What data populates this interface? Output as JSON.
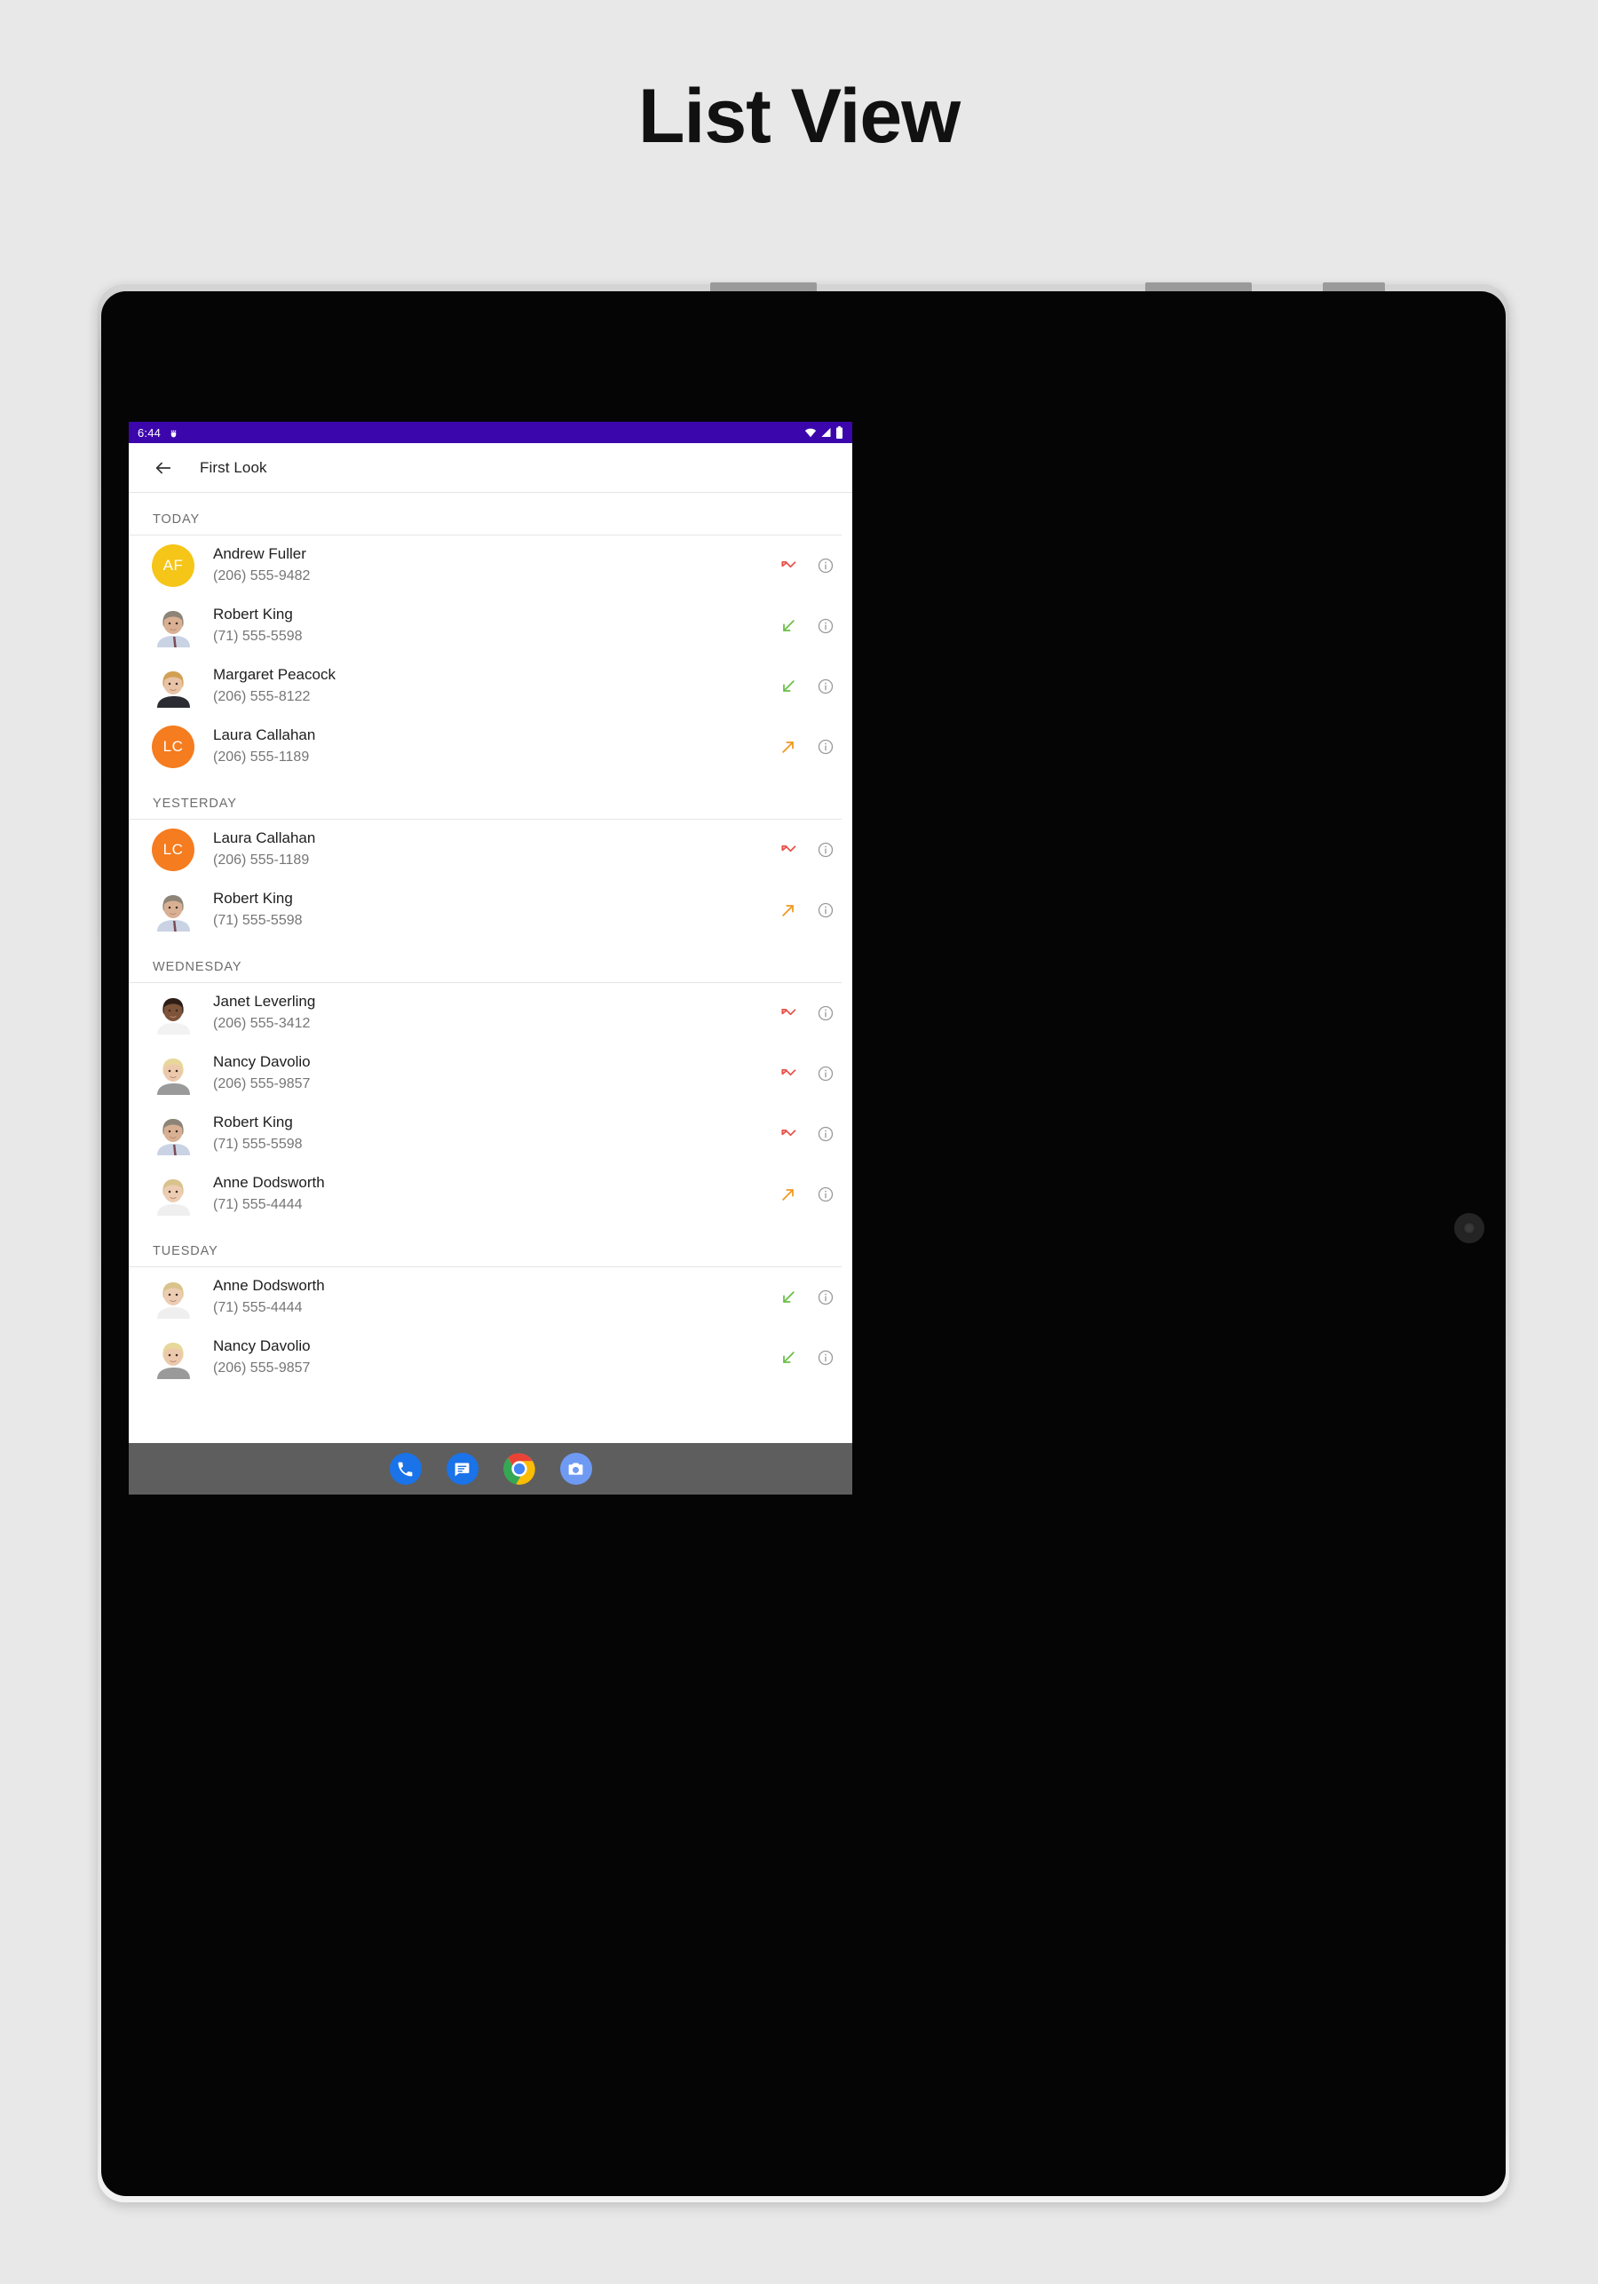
{
  "page": {
    "title": "List View",
    "background_color": "#e8e8e8"
  },
  "device": {
    "type": "tablet",
    "frame_color": "#050505"
  },
  "statusbar": {
    "time": "6:44",
    "background_color": "#3c06ad",
    "icons": [
      "android-debug-icon",
      "wifi-icon",
      "cellular-signal-icon",
      "battery-icon"
    ]
  },
  "appbar": {
    "back_label": "back-arrow",
    "title": "First Look"
  },
  "colors": {
    "accent_purple": "#3c06ad",
    "missed_call_red": "#e8534b",
    "incoming_call_green": "#6abf47",
    "outgoing_call_orange": "#f0981f",
    "avatar_yellow": "#f5c518",
    "avatar_orange": "#f57c1f",
    "navbar_gray": "#5e5e5e"
  },
  "sections": [
    {
      "header": "TODAY",
      "rows": [
        {
          "name": "Andrew Fuller",
          "phone": "(206) 555-9482",
          "avatar_type": "initials",
          "initials": "AF",
          "avatar_color": "#f5c518",
          "call_type": "missed"
        },
        {
          "name": "Robert King",
          "phone": "(71) 555-5598",
          "avatar_type": "photo",
          "photo": "robert-king",
          "call_type": "incoming"
        },
        {
          "name": "Margaret Peacock",
          "phone": "(206) 555-8122",
          "avatar_type": "photo",
          "photo": "margaret-peacock",
          "call_type": "incoming"
        },
        {
          "name": "Laura Callahan",
          "phone": "(206) 555-1189",
          "avatar_type": "initials",
          "initials": "LC",
          "avatar_color": "#f57c1f",
          "call_type": "outgoing"
        }
      ]
    },
    {
      "header": "YESTERDAY",
      "rows": [
        {
          "name": "Laura Callahan",
          "phone": "(206) 555-1189",
          "avatar_type": "initials",
          "initials": "LC",
          "avatar_color": "#f57c1f",
          "call_type": "missed"
        },
        {
          "name": "Robert King",
          "phone": "(71) 555-5598",
          "avatar_type": "photo",
          "photo": "robert-king",
          "call_type": "outgoing"
        }
      ]
    },
    {
      "header": "WEDNESDAY",
      "rows": [
        {
          "name": "Janet Leverling",
          "phone": "(206) 555-3412",
          "avatar_type": "photo",
          "photo": "janet-leverling",
          "call_type": "missed"
        },
        {
          "name": "Nancy Davolio",
          "phone": "(206) 555-9857",
          "avatar_type": "photo",
          "photo": "nancy-davolio",
          "call_type": "missed"
        },
        {
          "name": "Robert King",
          "phone": "(71) 555-5598",
          "avatar_type": "photo",
          "photo": "robert-king",
          "call_type": "missed"
        },
        {
          "name": "Anne Dodsworth",
          "phone": "(71) 555-4444",
          "avatar_type": "photo",
          "photo": "anne-dodsworth",
          "call_type": "outgoing"
        }
      ]
    },
    {
      "header": "TUESDAY",
      "rows": [
        {
          "name": "Anne Dodsworth",
          "phone": "(71) 555-4444",
          "avatar_type": "photo",
          "photo": "anne-dodsworth",
          "call_type": "incoming"
        },
        {
          "name": "Nancy Davolio",
          "phone": "(206) 555-9857",
          "avatar_type": "photo",
          "photo": "nancy-davolio",
          "call_type": "incoming"
        }
      ]
    }
  ],
  "navbar": {
    "apps": [
      {
        "name": "phone-app-icon",
        "label": "Phone"
      },
      {
        "name": "messages-app-icon",
        "label": "Messages"
      },
      {
        "name": "chrome-app-icon",
        "label": "Chrome"
      },
      {
        "name": "camera-app-icon",
        "label": "Camera"
      }
    ]
  }
}
